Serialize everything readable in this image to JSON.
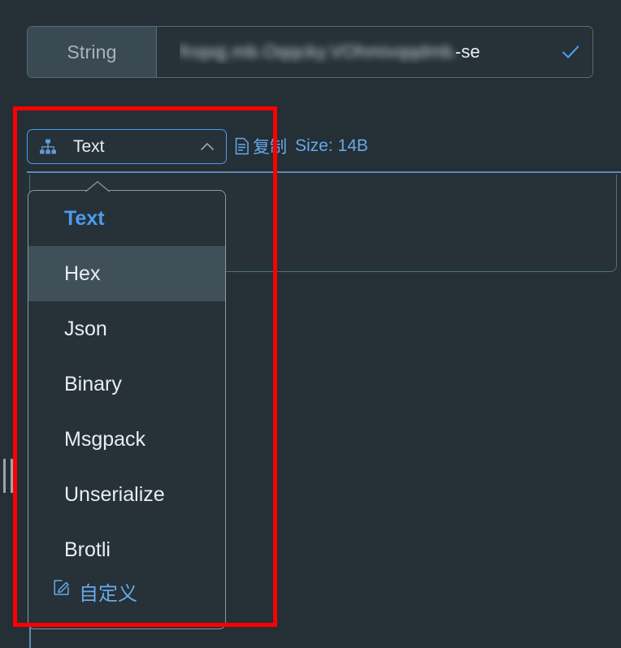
{
  "window": {
    "background_color": "#242f36"
  },
  "string_field": {
    "label": "String",
    "value_redacted": "fropqj.mb.Oqqcky.VOhmivqqdmb.",
    "value_tail": "-se",
    "confirm_icon": "check-icon"
  },
  "format_selector": {
    "icon": "sitemap-icon",
    "label": "Text",
    "chevron": "chevron-up-icon",
    "expanded": true
  },
  "copy_group": {
    "icon": "copy-document-icon",
    "copy_label": "复制",
    "size_label": "Size: 14B"
  },
  "dropdown": {
    "items": [
      {
        "label": "Text",
        "state": "selected"
      },
      {
        "label": "Hex",
        "state": "hovered"
      },
      {
        "label": "Json",
        "state": "normal"
      },
      {
        "label": "Binary",
        "state": "normal"
      },
      {
        "label": "Msgpack",
        "state": "normal"
      },
      {
        "label": "Unserialize",
        "state": "normal"
      },
      {
        "label": "Brotli",
        "state": "normal"
      },
      {
        "label": "自定义",
        "state": "custom",
        "icon": "edit-square-icon"
      }
    ]
  },
  "annotation": {
    "type": "red-highlight-rectangle",
    "color": "#ff0000"
  },
  "colors": {
    "background": "#242f36",
    "panel": "#263138",
    "accent_blue": "#4c9cf0",
    "link_blue": "#68a9e8",
    "border": "#5a6b76",
    "hover_row": "#3f5059",
    "separator": "#5e8bb5",
    "annotation_red": "#ff0000"
  },
  "drag_handle": {
    "name": "panel-resize-handle"
  }
}
